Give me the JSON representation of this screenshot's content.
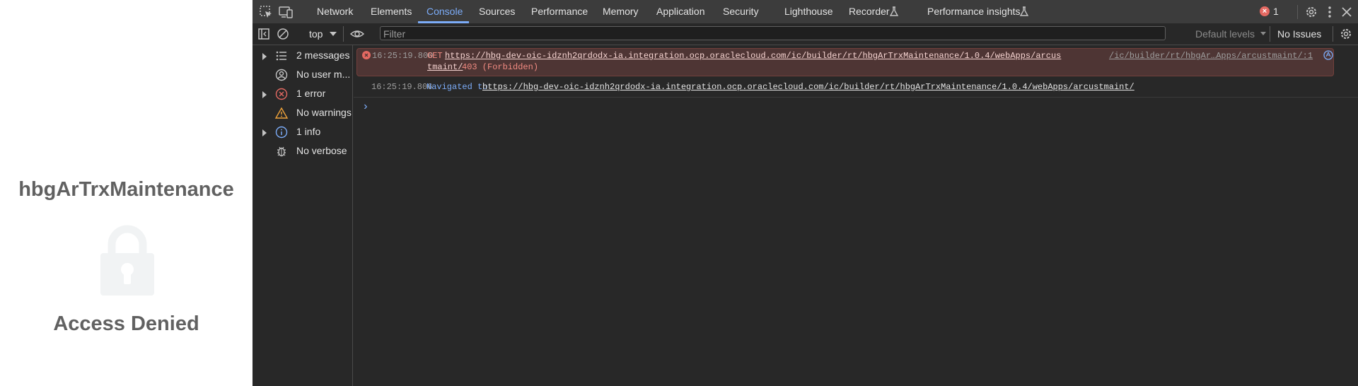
{
  "app": {
    "title": "hbgArTrxMaintenance",
    "status": "Access Denied",
    "lock_color": "#f1f3f4"
  },
  "devtools": {
    "tabs": [
      "Network",
      "Elements",
      "Console",
      "Sources",
      "Performance",
      "Memory",
      "Application",
      "Security",
      "Lighthouse",
      "Recorder",
      "Performance insights"
    ],
    "active_tab": "Console",
    "error_count": "1",
    "context": "top",
    "filter_placeholder": "Filter",
    "levels": "Default levels",
    "issues": "No Issues",
    "sidebar": [
      {
        "label": "2 messages",
        "icon": "list-icon",
        "expandable": true
      },
      {
        "label": "No user m...",
        "icon": "user-icon",
        "expandable": false
      },
      {
        "label": "1 error",
        "icon": "error-icon",
        "expandable": true
      },
      {
        "label": "No warnings",
        "icon": "warning-icon",
        "expandable": false
      },
      {
        "label": "1 info",
        "icon": "info-icon",
        "expandable": true
      },
      {
        "label": "No verbose",
        "icon": "bug-icon",
        "expandable": false
      }
    ],
    "messages": [
      {
        "level": "error",
        "time": "16:25:19.800",
        "method": "GET",
        "url_part1": "https://hbg-dev-oic-idznh2qrdodx-ia.integration.ocp.oraclecloud.com/ic/builder/rt/hbgArTrxMaintenance/1.0.4/webApps/arcus",
        "url_part2": "tmaint/",
        "status": "403 (Forbidden)",
        "source": "/ic/builder/rt/hbgAr…Apps/arcustmaint/:1"
      },
      {
        "level": "info",
        "time": "16:25:19.806",
        "prefix": "Navigated to",
        "url": "https://hbg-dev-oic-idznh2qrdodx-ia.integration.ocp.oraclecloud.com/ic/builder/rt/hbgArTrxMaintenance/1.0.4/webApps/arcustmaint/"
      }
    ],
    "prompt": "›"
  }
}
